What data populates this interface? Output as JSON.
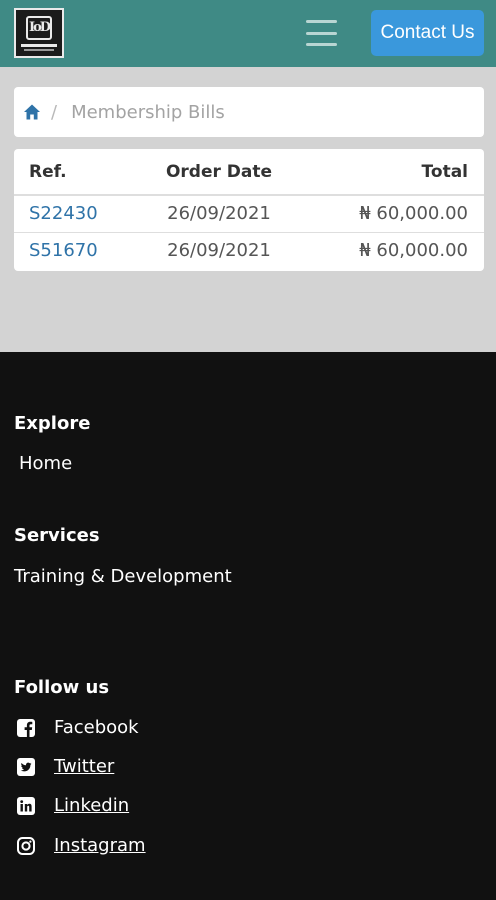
{
  "header": {
    "logo_text": "IoD",
    "contact_label": "Contact Us"
  },
  "breadcrumb": {
    "home_icon": "home-icon",
    "separator": "/",
    "current": "Membership Bills"
  },
  "bills": {
    "columns": [
      "Ref.",
      "Order Date",
      "Total"
    ],
    "rows": [
      {
        "ref": "S22430",
        "date": "26/09/2021",
        "total": "₦ 60,000.00"
      },
      {
        "ref": "S51670",
        "date": "26/09/2021",
        "total": "₦ 60,000.00"
      }
    ]
  },
  "footer": {
    "explore_heading": "Explore",
    "explore_links": [
      "Home"
    ],
    "services_heading": "Services",
    "services_links": [
      "Training & Development"
    ],
    "follow_heading": "Follow us",
    "social": [
      {
        "label": "Facebook",
        "icon": "facebook-icon"
      },
      {
        "label": "Twitter",
        "icon": "twitter-icon"
      },
      {
        "label": "Linkedin",
        "icon": "linkedin-icon"
      },
      {
        "label": "Instagram",
        "icon": "instagram-icon"
      }
    ]
  },
  "colors": {
    "header_bg": "#3f8a85",
    "button_bg": "#3a98dc",
    "link": "#2f73a8",
    "footer_bg": "#111111",
    "content_bg": "#d3d3d3"
  }
}
